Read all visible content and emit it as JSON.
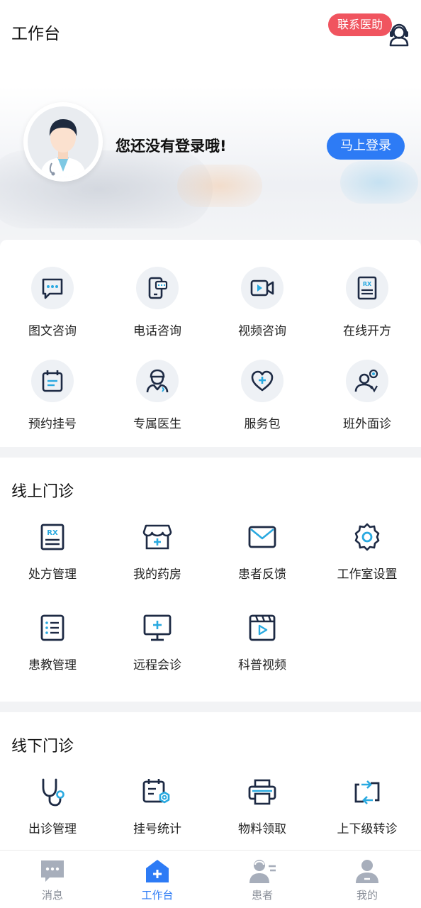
{
  "header": {
    "title": "工作台",
    "contact_label": "联系医助"
  },
  "profile": {
    "login_hint": "您还没有登录哦!",
    "login_button": "马上登录"
  },
  "services": [
    {
      "label": "图文咨询",
      "icon": "chat-bubble-icon"
    },
    {
      "label": "电话咨询",
      "icon": "phone-icon"
    },
    {
      "label": "视频咨询",
      "icon": "video-camera-icon"
    },
    {
      "label": "在线开方",
      "icon": "prescription-icon"
    },
    {
      "label": "预约挂号",
      "icon": "calendar-icon"
    },
    {
      "label": "专属医生",
      "icon": "doctor-icon"
    },
    {
      "label": "服务包",
      "icon": "heart-plus-icon"
    },
    {
      "label": "班外面诊",
      "icon": "person-badge-icon"
    }
  ],
  "online_clinic": {
    "title": "线上门诊",
    "items": [
      {
        "label": "处方管理",
        "icon": "prescription-icon"
      },
      {
        "label": "我的药房",
        "icon": "pharmacy-icon"
      },
      {
        "label": "患者反馈",
        "icon": "mail-icon"
      },
      {
        "label": "工作室设置",
        "icon": "gear-icon"
      },
      {
        "label": "患教管理",
        "icon": "list-icon"
      },
      {
        "label": "远程会诊",
        "icon": "monitor-plus-icon"
      },
      {
        "label": "科普视频",
        "icon": "video-clip-icon"
      }
    ]
  },
  "offline_clinic": {
    "title": "线下门诊",
    "items": [
      {
        "label": "出诊管理",
        "icon": "stethoscope-icon"
      },
      {
        "label": "挂号统计",
        "icon": "calendar-gear-icon"
      },
      {
        "label": "物料领取",
        "icon": "printer-icon"
      },
      {
        "label": "上下级转诊",
        "icon": "transfer-icon"
      }
    ]
  },
  "tabbar": {
    "active_index": 1,
    "tabs": [
      {
        "label": "消息",
        "icon": "message-icon"
      },
      {
        "label": "工作台",
        "icon": "workbench-icon"
      },
      {
        "label": "患者",
        "icon": "patients-icon"
      },
      {
        "label": "我的",
        "icon": "profile-icon"
      }
    ]
  },
  "colors": {
    "accent": "#2d7bf5",
    "badge": "#f0545f",
    "icon_dark": "#1d2a44",
    "icon_accent": "#29a9e0"
  }
}
